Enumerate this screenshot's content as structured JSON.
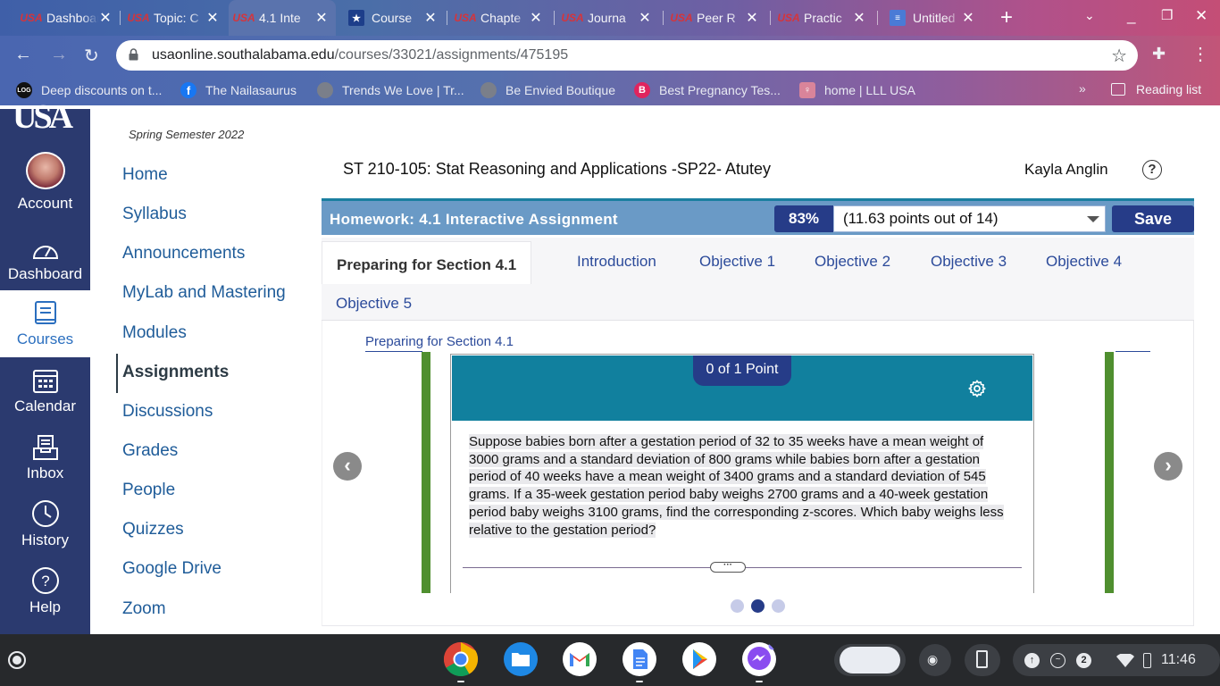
{
  "browser": {
    "tabs": [
      {
        "label": "Dashboard",
        "icon": "usa-logo"
      },
      {
        "label": "Topic: C",
        "icon": "usa-logo"
      },
      {
        "label": "4.1 Inte",
        "icon": "usa-logo",
        "active": true
      },
      {
        "label": "Course",
        "icon": "star-badge"
      },
      {
        "label": "Chapte",
        "icon": "usa-logo"
      },
      {
        "label": "Journa",
        "icon": "usa-logo"
      },
      {
        "label": "Peer R",
        "icon": "usa-logo"
      },
      {
        "label": "Practic",
        "icon": "usa-logo"
      },
      {
        "label": "Untitled",
        "icon": "docs-icon"
      }
    ],
    "url_host": "usaonline.southalabama.edu",
    "url_path": "/courses/33021/assignments/475195",
    "bookmarks": [
      {
        "label": "Deep discounts on t...",
        "color": "#111111",
        "icon_text": "LOG"
      },
      {
        "label": "The Nailasaurus",
        "color": "#1877f2",
        "icon_text": "f"
      },
      {
        "label": "Trends We Love | Tr...",
        "color": "#7a7f8a",
        "icon_text": ""
      },
      {
        "label": "Be Envied Boutique",
        "color": "#7a7f8a",
        "icon_text": ""
      },
      {
        "label": "Best Pregnancy Tes...",
        "color": "#e0245e",
        "icon_text": "B"
      },
      {
        "label": "home | LLL USA",
        "color": "#d9849a",
        "icon_text": "♀"
      }
    ],
    "more_bookmarks": "»",
    "reading_list": "Reading list"
  },
  "global_nav": {
    "items": [
      {
        "label": "Account",
        "icon": "avatar"
      },
      {
        "label": "Dashboard",
        "icon": "speedometer-icon"
      },
      {
        "label": "Courses",
        "icon": "book-icon"
      },
      {
        "label": "Calendar",
        "icon": "calendar-icon"
      },
      {
        "label": "Inbox",
        "icon": "inbox-icon"
      },
      {
        "label": "History",
        "icon": "clock-icon"
      },
      {
        "label": "Help",
        "icon": "question-icon"
      }
    ]
  },
  "course_nav": {
    "term": "Spring Semester 2022",
    "items": [
      "Home",
      "Syllabus",
      "Announcements",
      "MyLab and Mastering",
      "Modules",
      "Assignments",
      "Discussions",
      "Grades",
      "People",
      "Quizzes",
      "Google Drive",
      "Zoom"
    ],
    "active": "Assignments"
  },
  "header": {
    "course_title": "ST 210-105: Stat Reasoning and Applications -SP22- Atutey",
    "user_name": "Kayla Anglin",
    "help": "?"
  },
  "homework": {
    "title": "Homework: 4.1 Interactive Assignment",
    "score_percent": "83%",
    "score_detail": "(11.63 points out of 14)",
    "save_label": "Save",
    "tabs": [
      "Preparing for Section 4.1",
      "Introduction",
      "Objective 1",
      "Objective 2",
      "Objective 3",
      "Objective 4",
      "Objective 5"
    ],
    "active_tab": "Preparing for Section 4.1",
    "section_link": "Preparing for Section 4.1",
    "card": {
      "points": "0 of 1 Point",
      "question": "Suppose babies born after a gestation period of 32 to 35 weeks have a mean weight of 3000 grams and a standard deviation of 800 grams while babies born after a gestation period of 40 weeks have a mean weight of 3400 grams and a standard deviation of 545 grams. If a 35-week gestation period baby weighs 2700 grams and a 40-week gestation period baby weighs 3100 grams, find the corresponding z-scores. Which baby weighs less relative to the gestation period?",
      "ellipsis": "···"
    },
    "pager": {
      "count": 3,
      "current": 2
    },
    "colors": {
      "accent": "#263c88",
      "header_bar": "#6a9ac6",
      "card_head": "#11809e",
      "frame_green": "#4f8f2f"
    }
  },
  "shelf": {
    "apps": [
      "chrome-icon",
      "files-icon",
      "gmail-icon",
      "docs-icon",
      "play-store-icon",
      "messenger-icon"
    ],
    "time": "11:46",
    "notification_count": "2"
  }
}
